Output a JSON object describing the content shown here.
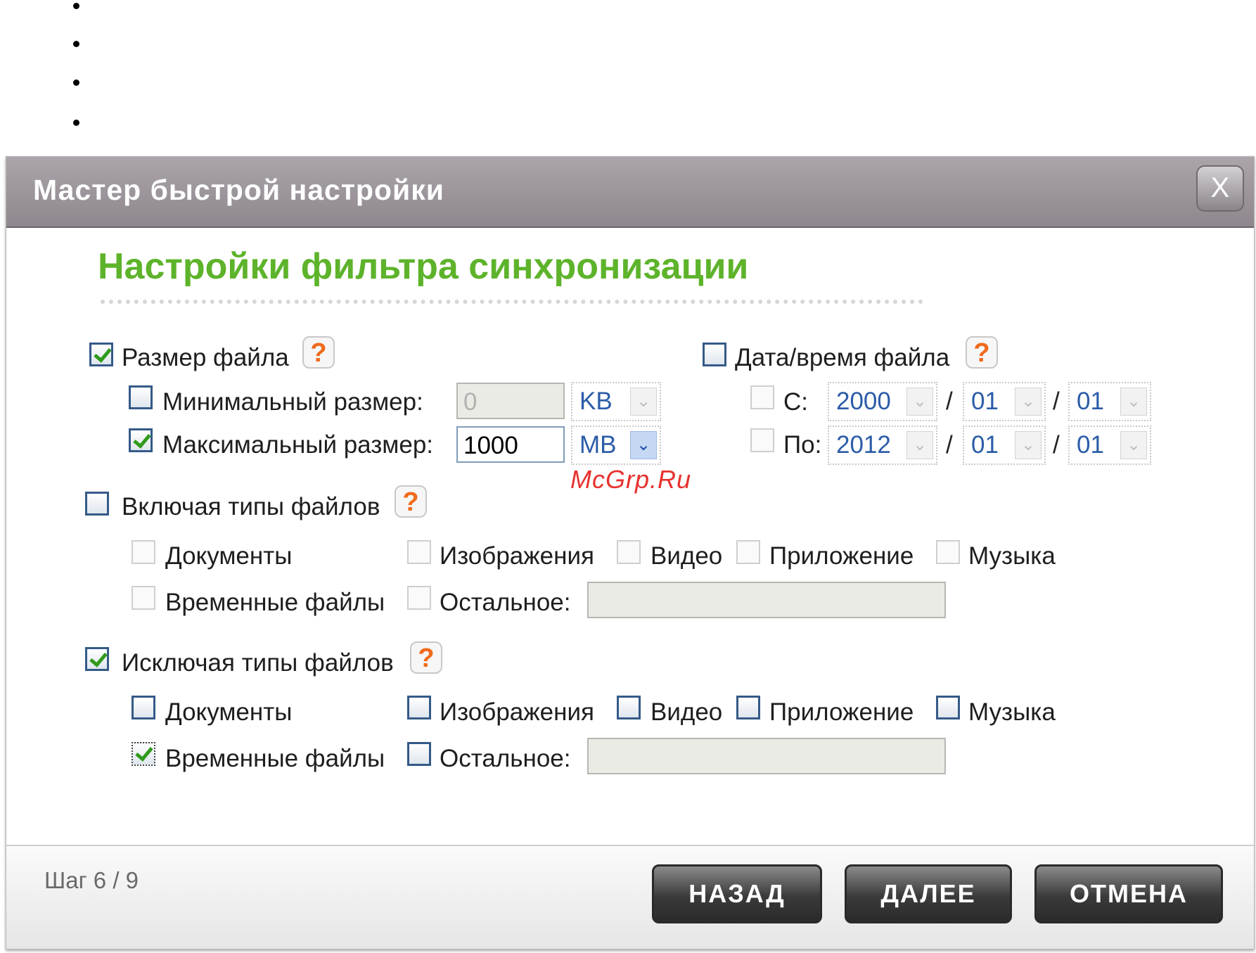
{
  "dialog": {
    "title": "Мастер быстрой настройки",
    "close_glyph": "X",
    "heading": "Настройки фильтра синхронизации"
  },
  "file_size": {
    "label": "Размер файла",
    "checked": true,
    "min": {
      "label": "Минимальный размер:",
      "checked": false,
      "value": "0",
      "unit": "KB"
    },
    "max": {
      "label": "Максимальный размер:",
      "checked": true,
      "value": "1000",
      "unit": "MB"
    }
  },
  "file_date": {
    "label": "Дата/время файла",
    "checked": false,
    "from": {
      "label": "С:",
      "year": "2000",
      "month": "01",
      "day": "01"
    },
    "to": {
      "label": "По:",
      "year": "2012",
      "month": "01",
      "day": "01"
    },
    "separator": "/"
  },
  "include_types": {
    "label": "Включая типы файлов",
    "checked": false,
    "documents": "Документы",
    "images": "Изображения",
    "video": "Видео",
    "application": "Приложение",
    "music": "Музыка",
    "temp": "Временные файлы",
    "other": "Остальное:"
  },
  "exclude_types": {
    "label": "Исключая типы файлов",
    "checked": true,
    "documents": "Документы",
    "images": "Изображения",
    "video": "Видео",
    "application": "Приложение",
    "music": "Музыка",
    "temp": "Временные файлы",
    "temp_checked": true,
    "other": "Остальное:"
  },
  "help_glyph": "?",
  "arrow_glyph": "⌄",
  "watermark": "McGrp.Ru",
  "footer": {
    "step": "Шаг 6 / 9",
    "back": "НАЗАД",
    "next": "ДАЛЕЕ",
    "cancel": "ОТМЕНА"
  }
}
